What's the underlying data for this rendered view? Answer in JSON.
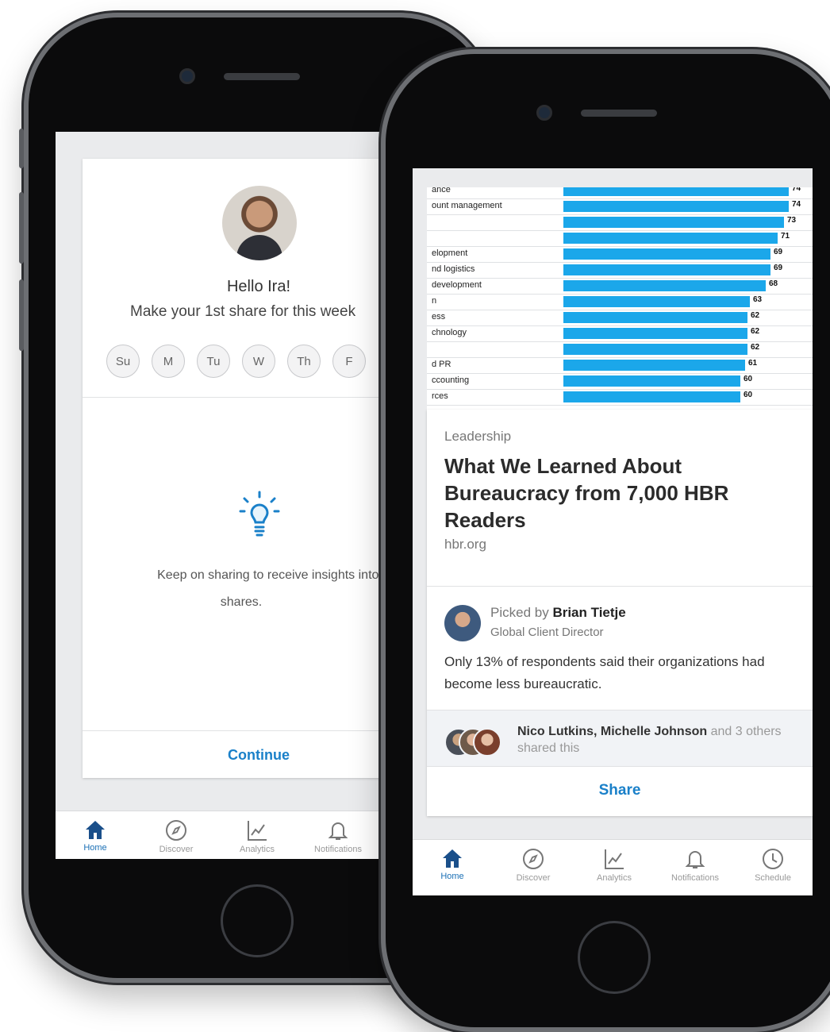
{
  "left_phone": {
    "greeting": "Hello Ira!",
    "subtitle": "Make your 1st share for this week",
    "days": [
      "Su",
      "M",
      "Tu",
      "W",
      "Th",
      "F"
    ],
    "insight_text": "Keep on sharing to receive insights into your shares.",
    "insight_line1": "Keep on sharing to receive insights into y",
    "insight_line2": "shares.",
    "continue_label": "Continue",
    "tabs": [
      {
        "label": "Home",
        "icon": "home-icon"
      },
      {
        "label": "Discover",
        "icon": "compass-icon"
      },
      {
        "label": "Analytics",
        "icon": "analytics-icon"
      },
      {
        "label": "Notifications",
        "icon": "bell-icon"
      }
    ]
  },
  "right_phone": {
    "chart_rows": [
      {
        "label": "ance",
        "value": "74",
        "fill": 0.98
      },
      {
        "label": "ount management",
        "value": "74",
        "fill": 0.98
      },
      {
        "label": "",
        "value": "73",
        "fill": 0.96
      },
      {
        "label": "",
        "value": "71",
        "fill": 0.93
      },
      {
        "label": "elopment",
        "value": "69",
        "fill": 0.9
      },
      {
        "label": "nd logistics",
        "value": "69",
        "fill": 0.9
      },
      {
        "label": "development",
        "value": "68",
        "fill": 0.88
      },
      {
        "label": "n",
        "value": "63",
        "fill": 0.81
      },
      {
        "label": "ess",
        "value": "62",
        "fill": 0.8
      },
      {
        "label": "chnology",
        "value": "62",
        "fill": 0.8
      },
      {
        "label": "",
        "value": "62",
        "fill": 0.8
      },
      {
        "label": "d PR",
        "value": "61",
        "fill": 0.79
      },
      {
        "label": "ccounting",
        "value": "60",
        "fill": 0.77
      },
      {
        "label": "rces",
        "value": "60",
        "fill": 0.77
      }
    ],
    "category": "Leadership",
    "article_title": "What We Learned About Bureaucracy from 7,000 HBR Readers",
    "source": "hbr.org",
    "picked_prefix": "Picked by",
    "picked_by": "Brian Tietje",
    "picked_role": "Global Client Director",
    "quote": "Only 13% of respondents said their organizations had become less bureaucratic.",
    "shared_names": "Nico Lutkins, Michelle Johnson",
    "shared_suffix": " and 3 others shared this",
    "share_label": "Share",
    "tabs": [
      {
        "label": "Home",
        "icon": "home-icon"
      },
      {
        "label": "Discover",
        "icon": "compass-icon"
      },
      {
        "label": "Analytics",
        "icon": "analytics-icon"
      },
      {
        "label": "Notifications",
        "icon": "bell-icon"
      },
      {
        "label": "Schedule",
        "icon": "clock-icon"
      }
    ]
  },
  "colors": {
    "accent": "#1a80c9",
    "bar": "#1ba7ea",
    "active_tab": "#1a6fb5"
  }
}
